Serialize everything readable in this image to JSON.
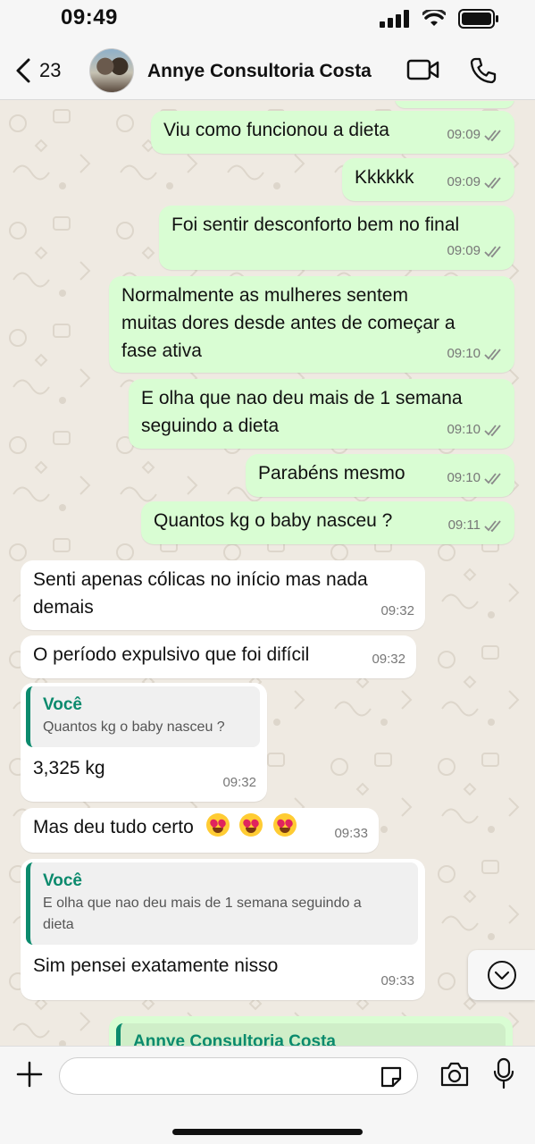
{
  "status_bar": {
    "time": "09:49"
  },
  "header": {
    "back_count": "23",
    "contact_name": "Annye Consultoria Costa"
  },
  "messages": [
    {
      "text": "Viu como funcionou a dieta",
      "time": "09:09"
    },
    {
      "text": "Kkkkkk",
      "time": "09:09"
    },
    {
      "text": "Foi sentir desconforto bem no final",
      "time": "09:09"
    },
    {
      "text": "Normalmente as mulheres sentem\nmuitas dores desde antes de começar a\nfase ativa",
      "time": "09:10"
    },
    {
      "text": "E olha que nao deu mais de 1 semana\nseguindo a dieta",
      "time": "09:10"
    },
    {
      "text": "Parabéns mesmo",
      "time": "09:10"
    },
    {
      "text": "Quantos kg o baby nasceu ?",
      "time": "09:11"
    },
    {
      "text": "Senti apenas cólicas no início mas nada\ndemais",
      "time": "09:32"
    },
    {
      "text": "O período expulsivo que foi difícil",
      "time": "09:32"
    },
    {
      "quote_author": "Você",
      "quote_text": "Quantos kg o baby nasceu ?",
      "text": "3,325 kg",
      "time": "09:32"
    },
    {
      "text": "Mas deu tudo certo",
      "time": "09:33"
    },
    {
      "quote_author": "Você",
      "quote_text": "E olha que nao deu mais de 1 semana seguindo a\ndieta",
      "text": "Sim pensei exatamente nisso",
      "time": "09:33"
    },
    {
      "quote_author": "Annye Consultoria Costa"
    }
  ],
  "composer": {
    "placeholder": ""
  },
  "colors": {
    "outgoing": "#d9fdd3",
    "incoming": "#ffffff",
    "accent": "#0b8a6d",
    "chat_bg": "#efeae2"
  },
  "icons": [
    "back-chevron-icon",
    "video-call-icon",
    "phone-icon",
    "read-receipt-icon",
    "scroll-down-icon",
    "plus-icon",
    "sticker-icon",
    "camera-icon",
    "microphone-icon"
  ]
}
